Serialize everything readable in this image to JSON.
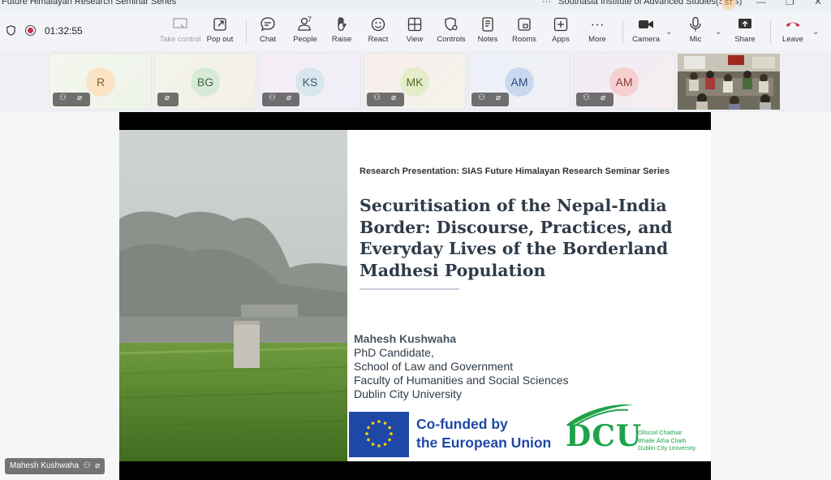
{
  "window": {
    "title": "Future Himalayan Research Seminar Series",
    "organization": "Southasia Institute of Advanced Studies(SIAS)",
    "account_initials": "ST"
  },
  "toolbar": {
    "timer": "01:32:55",
    "buttons": {
      "take_control": "Take control",
      "pop_out": "Pop out",
      "chat": "Chat",
      "people": "People",
      "people_count": "7",
      "raise": "Raise",
      "react": "React",
      "view": "View",
      "controls": "Controls",
      "notes": "Notes",
      "rooms": "Rooms",
      "apps": "Apps",
      "more": "More",
      "camera": "Camera",
      "mic": "Mic",
      "share": "Share",
      "leave": "Leave"
    },
    "leave_color": "#c4314b"
  },
  "participants": [
    {
      "initials": "R",
      "bg": "#fbe3c6",
      "color": "#8c5a1e"
    },
    {
      "initials": "BG",
      "bg": "#d7ead7",
      "color": "#3d6b3d"
    },
    {
      "initials": "KS",
      "bg": "#d8e6ee",
      "color": "#3a5a70"
    },
    {
      "initials": "MK",
      "bg": "#e3edc9",
      "color": "#5a6b2a"
    },
    {
      "initials": "AM",
      "bg": "#c9d8ef",
      "color": "#2c4a7a"
    },
    {
      "initials": "AM",
      "bg": "#f6cfd0",
      "color": "#8a3a3a"
    }
  ],
  "slide": {
    "heading": "Research Presentation: SIAS Future Himalayan Research Seminar Series",
    "title_lines": [
      "Securitisation of the Nepal-India",
      "Border: Discourse, Practices, and",
      "Everyday Lives of the Borderland",
      "Madhesi Population"
    ],
    "author_name": "Mahesh Kushwaha",
    "author_lines": [
      "PhD Candidate,",
      "School of Law and Government",
      "Faculty of Humanities and Social Sciences",
      "Dublin City University"
    ],
    "eu_text_1": "Co-funded by",
    "eu_text_2": "the European Union",
    "dcu_short": "DCU",
    "dcu_lines": [
      "Ollscoil Chathair",
      "Bhaile Átha Cliath",
      "Dublin City University"
    ]
  },
  "presenter": {
    "name": "Mahesh Kushwaha"
  }
}
